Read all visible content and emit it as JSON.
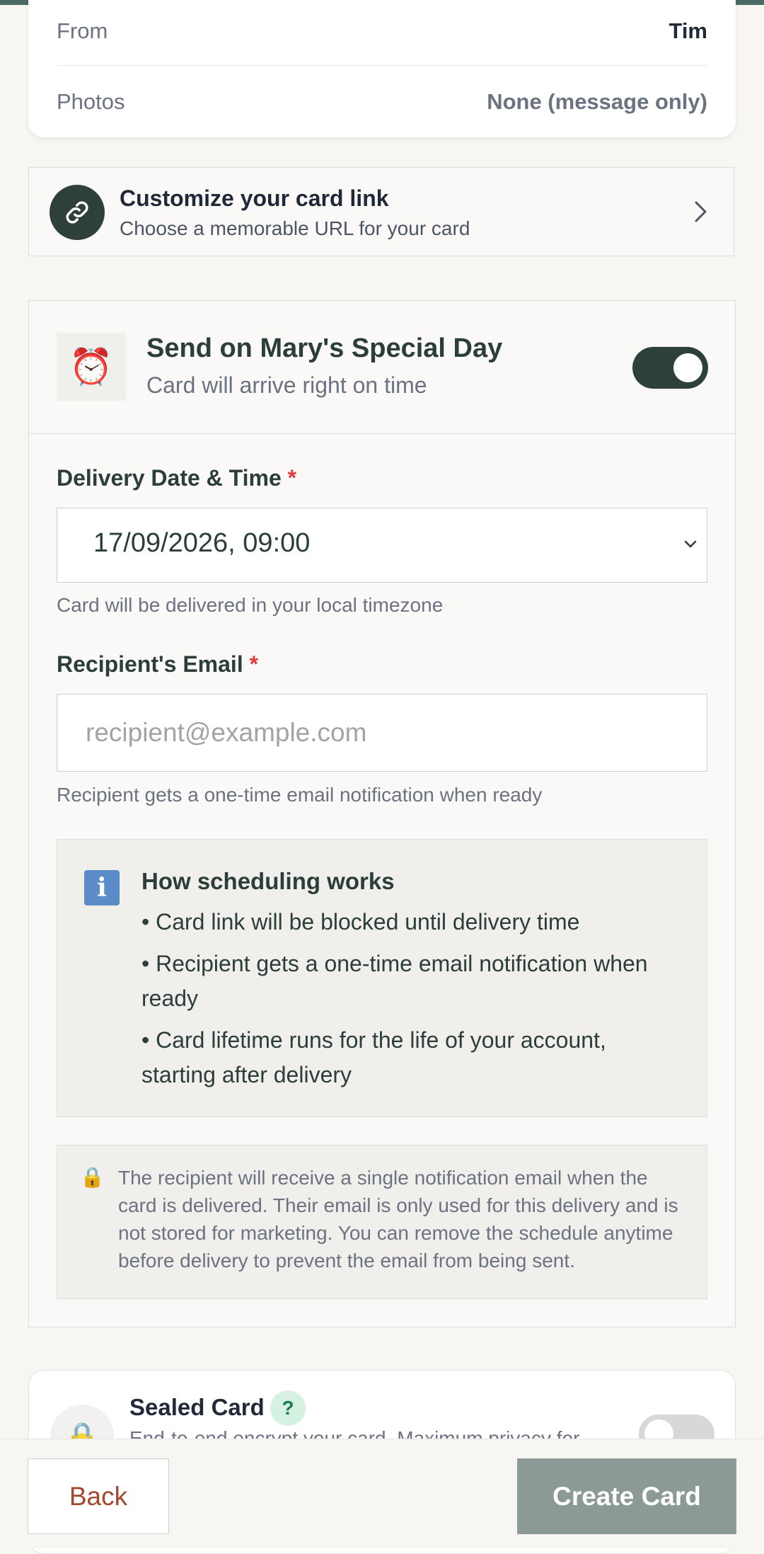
{
  "summary": {
    "from_label": "From",
    "from_value": "Tim",
    "photos_label": "Photos",
    "photos_value": "None (message only)"
  },
  "customize": {
    "title": "Customize your card link",
    "subtitle": "Choose a memorable URL for your card",
    "icon": "link-icon"
  },
  "schedule": {
    "icon": "alarm-clock-icon",
    "title": "Send on Mary's Special Day",
    "subtitle": "Card will arrive right on time",
    "enabled": true,
    "date_label": "Delivery Date & Time",
    "required_mark": "*",
    "date_value": "17/09/2026, 09:00",
    "date_hint": "Card will be delivered in your local timezone",
    "email_label": "Recipient's Email",
    "email_placeholder": "recipient@example.com",
    "email_value": "",
    "email_hint": "Recipient gets a one-time email notification when ready",
    "info": {
      "icon": "info-icon",
      "title": "How scheduling works",
      "items": [
        "• Card link will be blocked until delivery time",
        "• Recipient gets a one-time email notification when ready",
        "• Card lifetime runs for the life of your account, starting after delivery"
      ]
    },
    "privacy": {
      "icon": "lock-icon",
      "text": "The recipient will receive a single notification email when the card is delivered. Their email is only used for this delivery and is not stored for marketing. You can remove the schedule anytime before delivery to prevent the email from being sent."
    }
  },
  "sealed": {
    "icon": "lock-icon",
    "title": "Sealed Card",
    "help": "?",
    "subtitle": "End-to-end encrypt your card. Maximum privacy for",
    "enabled": false
  },
  "footer": {
    "back_label": "Back",
    "create_label": "Create Card"
  },
  "colors": {
    "accent": "#2d403c",
    "required": "#e23b3b",
    "back_text": "#a3472e",
    "create_disabled": "#8c9a97"
  }
}
